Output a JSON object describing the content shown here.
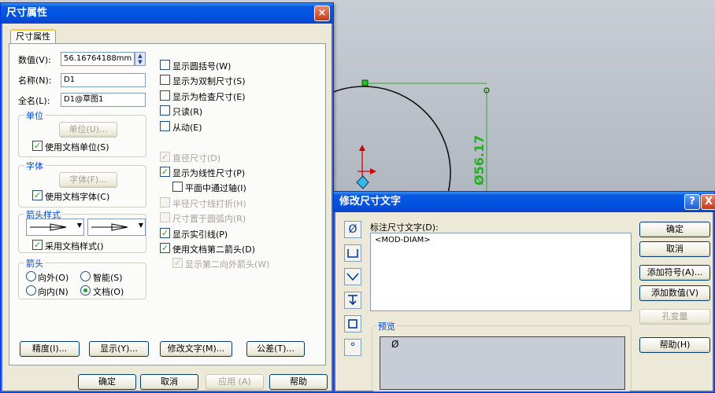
{
  "canvas": {
    "dimension_text": "Ø56.17"
  },
  "dim_props": {
    "title": "尺寸属性",
    "tab": "尺寸属性",
    "value_label": "数值(V):",
    "value": "56.16764188mm",
    "name_label": "名称(N):",
    "name": "D1",
    "fullname_label": "全名(L):",
    "fullname": "D1@草图1",
    "unit_group": "单位",
    "unit_button": "单位(U)...",
    "use_doc_units": "使用文档单位(S)",
    "font_group": "字体",
    "font_button": "字体(F)...",
    "use_doc_font": "使用文档字体(C)",
    "arrow_style_group": "箭头样式",
    "use_doc_style": "采用文档样式()",
    "arrows_group": "箭头",
    "arrow_out": "向外(O)",
    "arrow_smart": "智能(S)",
    "arrow_in": "向内(N)",
    "arrow_doc": "文档(O)",
    "options": [
      {
        "label": "显示圆括号(W)",
        "checked": false,
        "enabled": true
      },
      {
        "label": "显示为双制尺寸(S)",
        "checked": false,
        "enabled": true
      },
      {
        "label": "显示为检查尺寸(E)",
        "checked": false,
        "enabled": true
      },
      {
        "label": "只读(R)",
        "checked": false,
        "enabled": true
      },
      {
        "label": "从动(E)",
        "checked": false,
        "enabled": true
      },
      {
        "label": "直径尺寸(D)",
        "checked": true,
        "enabled": false
      },
      {
        "label": "显示为线性尺寸(P)",
        "checked": true,
        "enabled": true
      },
      {
        "label": "平面中通过轴(I)",
        "checked": false,
        "enabled": true
      },
      {
        "label": "半径尺寸线打折(H)",
        "checked": false,
        "enabled": false
      },
      {
        "label": "尺寸置于圆弧内(R)",
        "checked": false,
        "enabled": false
      },
      {
        "label": "显示实引线(P)",
        "checked": true,
        "enabled": true
      },
      {
        "label": "使用文档第二箭头(D)",
        "checked": true,
        "enabled": true
      },
      {
        "label": "显示第二向外箭头(W)",
        "checked": true,
        "enabled": false
      }
    ],
    "btn_precision": "精度(I)...",
    "btn_display": "显示(Y)...",
    "btn_modify_text": "修改文字(M)...",
    "btn_tolerance": "公差(T)...",
    "btn_ok": "确定",
    "btn_cancel": "取消",
    "btn_apply": "应用 (A)",
    "btn_help": "帮助"
  },
  "modify_text": {
    "title": "修改尺寸文字",
    "help_btn": "?",
    "close_btn": "X",
    "field_label": "标注尺寸文字(D):",
    "field_value": "<MOD-DIAM>",
    "preview_label": "预览",
    "preview_value": "Ø",
    "btn_ok": "确定",
    "btn_cancel": "取消",
    "btn_add_symbol": "添加符号(A)...",
    "btn_add_value": "添加数值(V)",
    "btn_hole": "孔变量",
    "btn_help": "帮助(H)",
    "symbol_icons": [
      "diameter-icon",
      "counterbore-icon",
      "countersink-icon",
      "depth-icon",
      "square-icon",
      "degree-icon"
    ]
  }
}
